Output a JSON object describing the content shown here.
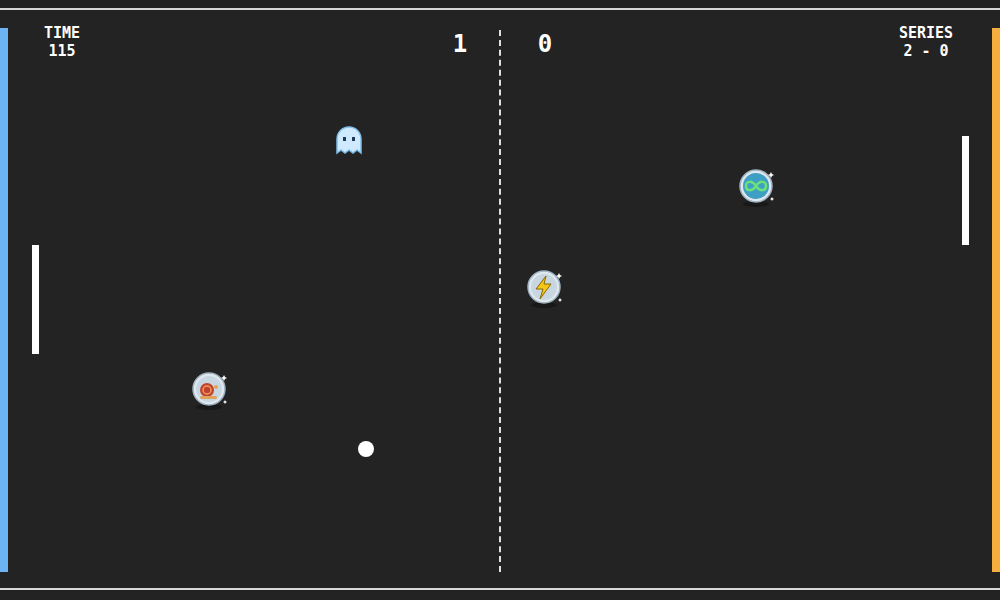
{
  "hud": {
    "time_label": "TIME",
    "time_value": "115",
    "series_label": "SERIES",
    "series_value": "2 - 0"
  },
  "scores": {
    "left": "1",
    "right": "0"
  },
  "players": [
    {
      "side": "left",
      "color": "#6bb3f2"
    },
    {
      "side": "right",
      "color": "#f5ad3d"
    }
  ],
  "powerups": [
    {
      "kind": "ghost"
    },
    {
      "kind": "slow"
    },
    {
      "kind": "speed"
    },
    {
      "kind": "multi"
    }
  ]
}
